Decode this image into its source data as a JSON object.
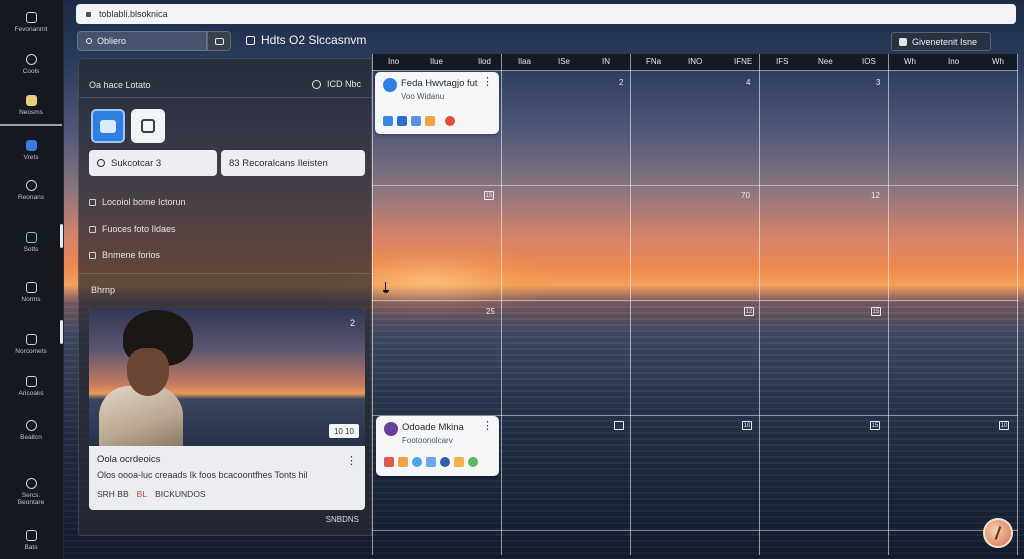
{
  "url": "toblabli.blsoknica",
  "sidebar": {
    "items": [
      {
        "label": "Fevonanrnt",
        "icon": "home-icon"
      },
      {
        "label": "Cools",
        "icon": "globe-icon"
      },
      {
        "label": "Neosms",
        "icon": "grid-icon"
      },
      {
        "label": "Vrets",
        "icon": "shield-icon"
      },
      {
        "label": "Reonans",
        "icon": "settings-icon"
      },
      {
        "label": "Sotts",
        "icon": "anchor-icon"
      },
      {
        "label": "Norms",
        "icon": "bell-icon"
      },
      {
        "label": "Norcomets",
        "icon": "layers-icon"
      },
      {
        "label": "Aricoaks",
        "icon": "chart-icon"
      },
      {
        "label": "Beaitcn",
        "icon": "clock-icon"
      },
      {
        "label": "Sercs.\nBeontare",
        "icon": "user-icon"
      },
      {
        "label": "Bats",
        "icon": "gear-icon"
      }
    ]
  },
  "search": {
    "placeholder": "Obliero"
  },
  "calendar_title": "Hdts O2 Slccasnvm",
  "top_right_button": "Givenetenit Isne",
  "panel": {
    "header": "Oa hace Lotato",
    "header_right": "ICD Nbc",
    "button_one": "Sukcotcar 3",
    "button_two": "83 Recoralcans Ileisten",
    "list": [
      "Locoiol bome Ictorun",
      "Fuoces foto Ildaes",
      "Bnmene forios"
    ],
    "section": "Bhrnp",
    "photo_number": "2",
    "photo_chip": "10 10",
    "card_title": "Oola ocrdeoics",
    "card_sub": "Olos oooa-luc creaads Ik foos bcacoontfhes Tonts hil",
    "card_meta_left": "SRH BB",
    "card_meta_tag": "BL",
    "card_meta_right": "BICKUNDOS",
    "footer": "SNBDNS"
  },
  "calendar": {
    "day_names": [
      "Ino",
      "Ilue",
      "Ilod",
      "Ilaa",
      "ISe",
      "IN",
      "FNa",
      "INO",
      "IFNE",
      "IFS",
      "Nee",
      "IOS",
      "Wh"
    ],
    "cell_numbers": {
      "row1": [
        "",
        "2",
        "4",
        "3",
        "",
        ""
      ],
      "row2": [
        "15",
        "",
        "70",
        "",
        "12",
        ""
      ],
      "row3": [
        "25",
        "",
        "",
        "12",
        "15",
        ""
      ],
      "row4": [
        "",
        "",
        "",
        "10",
        "15",
        "10"
      ]
    }
  },
  "events": [
    {
      "title": "Feda Hwvtagjo fut",
      "sub": "Voo Widanu",
      "avatar_color": "#2f7fe0"
    },
    {
      "title": "Odoade Mkina",
      "sub": "Footoonolcarv",
      "avatar_color": "#6a3f9a",
      "avatar_letter": "6"
    }
  ],
  "colors": {
    "accent": "#2e7fe0",
    "sidebar_bg": "#131821",
    "active_icon": "#e9cf7a"
  }
}
